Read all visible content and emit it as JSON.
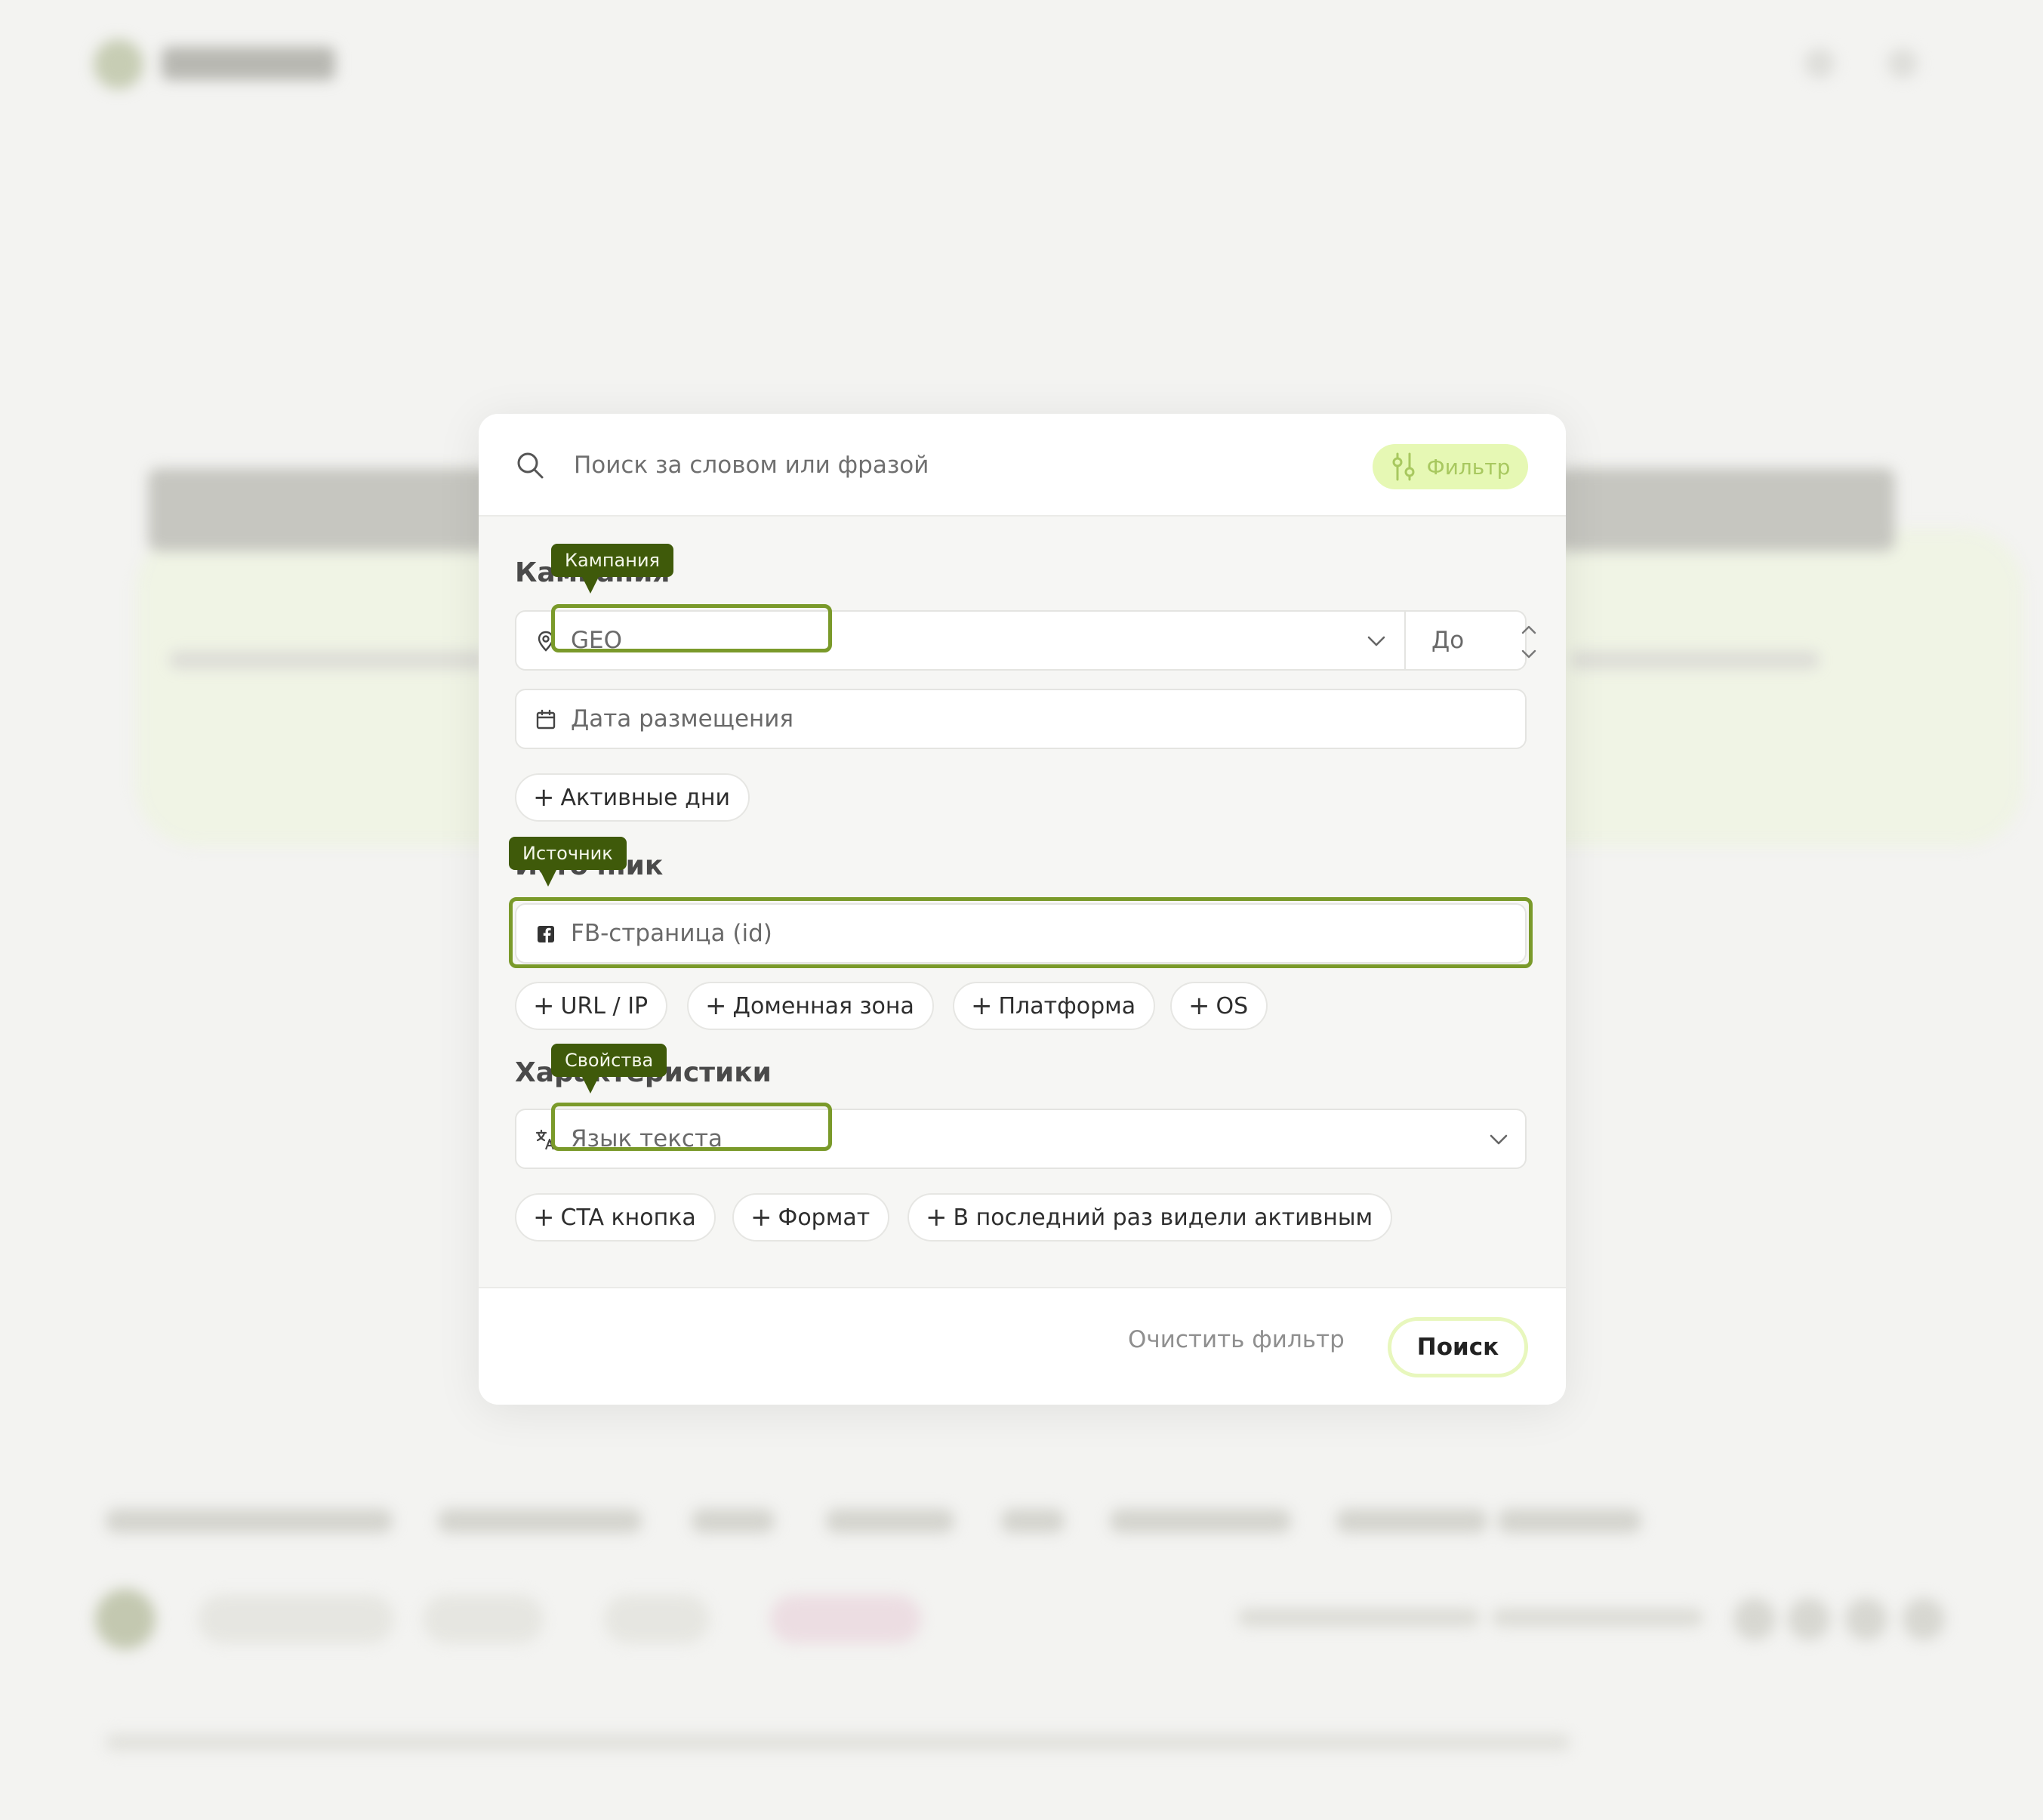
{
  "search": {
    "placeholder": "Поиск за словом или фразой",
    "filter_label": "Фильтр"
  },
  "sections": {
    "campaign": {
      "title": "Кампания",
      "geo_placeholder": "GEO",
      "do_label": "До",
      "date_placeholder": "Дата размещения",
      "chips": [
        "Активные дни"
      ]
    },
    "source": {
      "title": "Источник",
      "fb_placeholder": "FB-страница (id)",
      "chips": [
        "URL / IP",
        "Доменная зона",
        "Платформа",
        "OS"
      ]
    },
    "properties": {
      "title": "Характеристики",
      "lang_placeholder": "Язык текста",
      "chips": [
        "CTA кнопка",
        "Формат",
        "В последний раз видели активным"
      ]
    }
  },
  "tooltips": {
    "campaign": "Кампания",
    "source": "Источник",
    "properties": "Свойства"
  },
  "footer": {
    "clear_label": "Очистить фильтр",
    "search_label": "Поиск"
  },
  "colors": {
    "accent_green": "#7a9a2a",
    "tooltip_bg": "#3f5a0a",
    "filter_bg": "#e6f8b4",
    "filter_text": "#a8c85f"
  },
  "icons": {
    "search": "search-icon",
    "filter": "filter-sliders-icon",
    "geo": "map-pin-icon",
    "date": "calendar-icon",
    "fb": "facebook-icon",
    "lang": "translate-icon"
  }
}
